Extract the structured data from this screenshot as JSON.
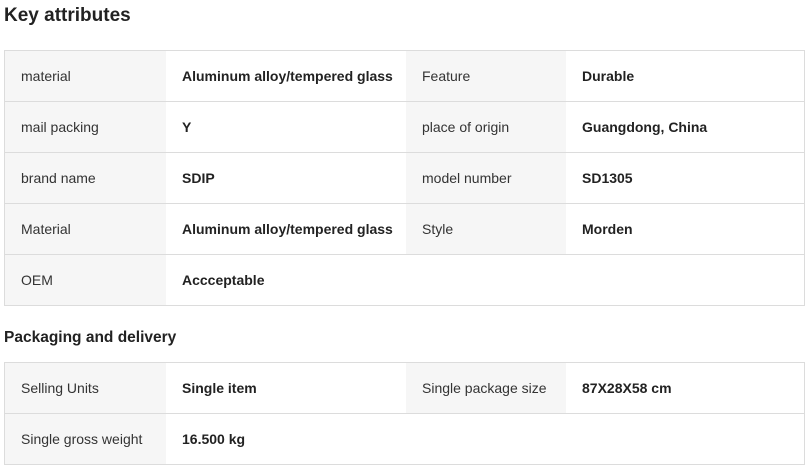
{
  "key_attributes": {
    "title": "Key attributes",
    "rows": [
      [
        {
          "label": "material",
          "value": "Aluminum alloy/tempered glass"
        },
        {
          "label": "Feature",
          "value": "Durable"
        }
      ],
      [
        {
          "label": "mail packing",
          "value": "Y"
        },
        {
          "label": "place of origin",
          "value": "Guangdong, China"
        }
      ],
      [
        {
          "label": "brand name",
          "value": "SDIP"
        },
        {
          "label": "model number",
          "value": "SD1305"
        }
      ],
      [
        {
          "label": "Material",
          "value": "Aluminum alloy/tempered glass"
        },
        {
          "label": "Style",
          "value": "Morden"
        }
      ],
      [
        {
          "label": "OEM",
          "value": "Accceptable"
        }
      ]
    ]
  },
  "packaging": {
    "title": "Packaging and delivery",
    "rows": [
      [
        {
          "label": "Selling Units",
          "value": "Single item"
        },
        {
          "label": "Single package size",
          "value": "87X28X58 cm"
        }
      ],
      [
        {
          "label": "Single gross weight",
          "value": "16.500 kg"
        }
      ]
    ]
  }
}
